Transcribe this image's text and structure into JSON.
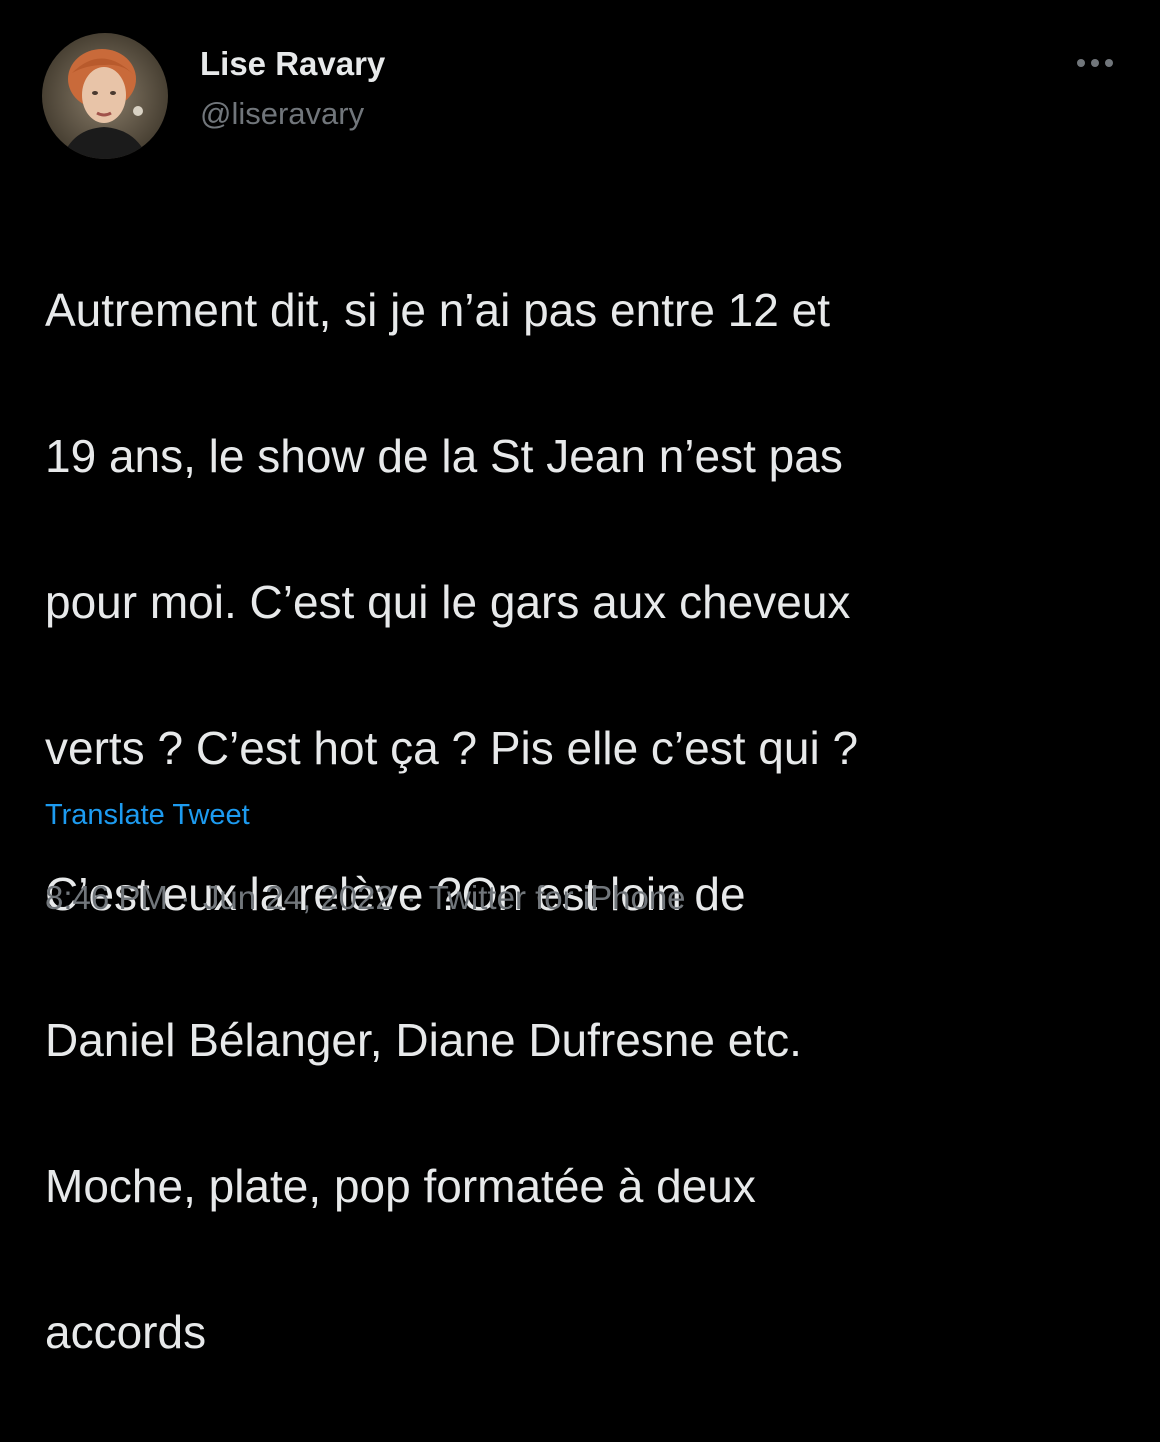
{
  "author": {
    "display_name": "Lise Ravary",
    "handle": "@liseravary",
    "avatar_icon": "profile-photo-avatar"
  },
  "menu": {
    "more_icon": "more-horizontal-icon"
  },
  "tweet": {
    "text_lines": [
      "Autrement dit, si je n’ai pas entre 12 et",
      "19 ans, le show de la St Jean n’est pas",
      "pour moi. C’est qui le gars aux cheveux",
      "verts ? C’est hot ça ? Pis elle c’est qui ?",
      "C’est eux la relève ?On est loin de",
      "Daniel Bélanger, Diane Dufresne etc.",
      "Moche, plate, pop formatée à deux",
      "accords"
    ],
    "translate_label": "Translate Tweet"
  },
  "meta": {
    "time": "8:46 PM",
    "separator": "·",
    "date": "Jun 24, 2022",
    "source": "Twitter for iPhone"
  },
  "colors": {
    "background": "#000000",
    "primary_text": "#e7e9ea",
    "secondary_text": "#71767b",
    "link": "#1d9bf0"
  }
}
